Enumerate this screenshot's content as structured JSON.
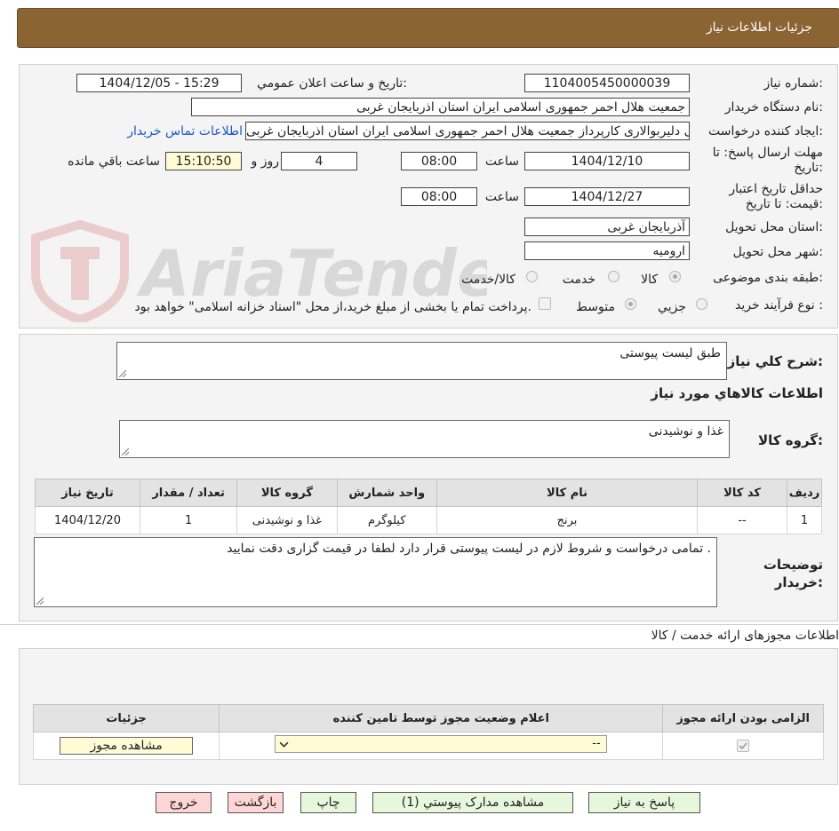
{
  "header": {
    "title": "جزئیات اطلاعات نیاز"
  },
  "form": {
    "need_number_label": "شماره نیاز:",
    "need_number": "1104005450000039",
    "announce_label": "تاریخ و ساعت اعلان عمومي:",
    "announce_value": "1404/12/05 - 15:29",
    "buyer_org_label": "نام دستگاه خريدار:",
    "buyer_org": "جمعيت هلال احمر جمهوری اسلامی ايران استان اذربايجان غربی",
    "creator_label": "ايجاد کننده درخواست:",
    "creator": "علی دلیربوالاری کارپرداز جمعیت هلال احمر جمهوری اسلامی ایران استان اذربایجان غربی",
    "contact_link": "اطلاعات تماس خريدار",
    "deadline_label": "مهلت ارسال پاسخ: تا تاریخ:",
    "deadline_date": "1404/12/10",
    "time_label": "ساعت",
    "deadline_time": "08:00",
    "days": "4",
    "days_label": "روز و",
    "remaining": "15:10:50",
    "remaining_label": "ساعت باقي مانده",
    "validity_label": "حداقل تاريخ اعتبار قيمت: تا تاريخ:",
    "validity_date": "1404/12/27",
    "validity_time": "08:00",
    "province_label": "استان محل تحويل:",
    "province": "آذربایجان غربی",
    "city_label": "شهر محل تحويل:",
    "city": "ارومیه",
    "category_label": "طبقه بندی موضوعی:",
    "category_options": [
      "کالا",
      "خدمت",
      "کالا/خدمت"
    ],
    "process_label": "نوع فرآيند خريد :",
    "process_options": [
      "جزيي",
      "متوسط"
    ],
    "payment_note": "پرداخت تمام یا بخشی از مبلغ خرید،از محل \"اسناد خزانه اسلامی\" خواهد بود."
  },
  "summary": {
    "description_label": "شرح کلي نياز:",
    "description": "طبق لیست پیوستی",
    "goods_info_title": "اطلاعات کالاهاي مورد نياز",
    "goods_group_label": "گروه کالا:",
    "goods_group": "غذا و نوشیدنی",
    "table_headers": [
      "رديف",
      "کد کالا",
      "نام کالا",
      "واحد شمارش",
      "گروه کالا",
      "تعداد / مقدار",
      "تاريخ نياز"
    ],
    "table_rows": [
      [
        "1",
        "--",
        "برنج",
        "کیلوگرم",
        "غذا و نوشیدنی",
        "1",
        "1404/12/20"
      ]
    ],
    "buyer_notes_label": "توضيحات خريدار:",
    "buyer_notes": "تمامی درخواست و شروط لازم در لیست پیوستی قرار دارد لطفا در قیمت گزاری دقت نمایید ."
  },
  "permits": {
    "title": "اطلاعات مجوزهای ارائه خدمت / کالا",
    "headers": [
      "الزامی بودن ارائه مجوز",
      "اعلام وضعیت مجوز توسط تامین کننده",
      "جزئيات"
    ],
    "select_value": "--",
    "view_button": "مشاهده مجوز"
  },
  "buttons": {
    "reply": "پاسخ به نياز",
    "attachments": "مشاهده مدارک پيوستي (1)",
    "print": "چاپ",
    "back": "بازگشت",
    "exit": "خروج"
  },
  "colors": {
    "header_bg": "#8b6434",
    "link": "#1a55c9",
    "exit_bg": "#ffd6d6",
    "action_bg": "#e6f7dc"
  }
}
